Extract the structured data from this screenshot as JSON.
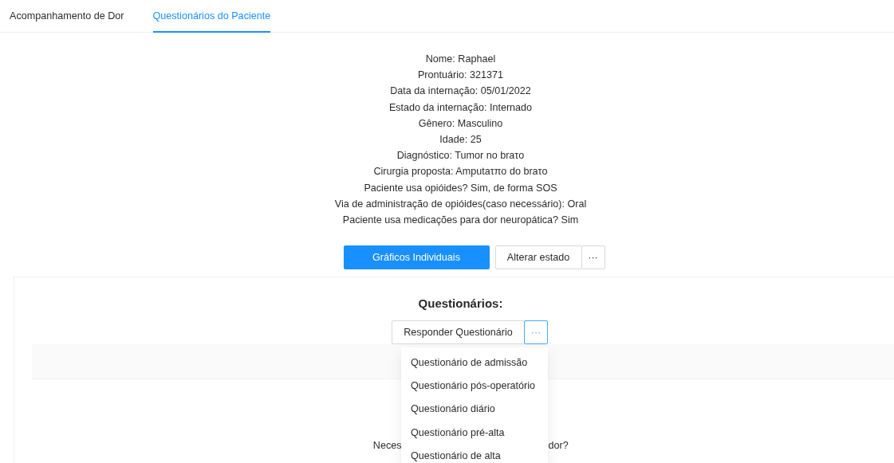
{
  "tabs": [
    {
      "label": "Acompanhamento de Dor",
      "selected": false
    },
    {
      "label": "Questionários do Paciente",
      "selected": true
    }
  ],
  "patient_info": [
    "Nome: Raphael",
    "Prontuário: 321371",
    "Data da internação: 05/01/2022",
    "Estado da internação: Internado",
    "Gênero: Masculino",
    "Idade: 25",
    "Diagnóstico: Tumor no braτo",
    "Cirurgia proposta: Amputaτπo do braτo",
    "Paciente usa opióides? Sim, de forma SOS",
    "Via de administração de opióides(caso necessário): Oral",
    "Paciente usa medicações para dor neuropática? Sim"
  ],
  "actions": {
    "primary": "Gráficos Individuais",
    "secondary": "Alterar estado",
    "more": "···"
  },
  "questionnaires": {
    "title": "Questionários:",
    "button": "Responder Questionário",
    "more": "···",
    "menu_open": true,
    "menu": [
      "Questionário de admissão",
      "Questionário pós-operatório",
      "Questionário diário",
      "Questionário pré-alta",
      "Questionário de alta"
    ],
    "body_text_left": "Neces",
    "body_text_right": "dor?"
  }
}
